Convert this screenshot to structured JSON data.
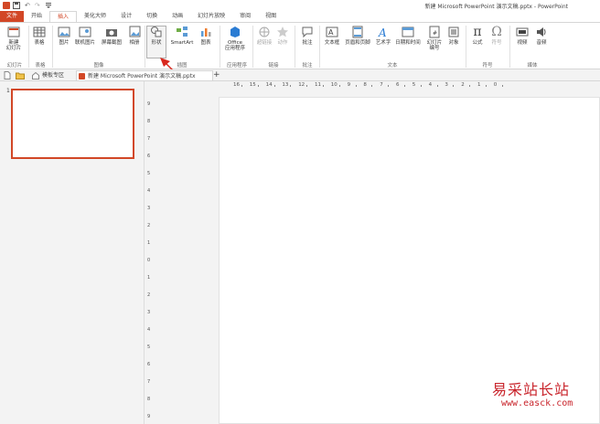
{
  "quick_access": {
    "undo": "↶",
    "redo": "↷"
  },
  "window_title": "新建 Microsoft PowerPoint 演示文稿.pptx - PowerPoint",
  "tabs": [
    "文件",
    "开始",
    "插入",
    "美化大师",
    "设计",
    "切换",
    "动画",
    "幻灯片放映",
    "审阅",
    "视图"
  ],
  "ribbon": {
    "new_slide": [
      "新建",
      "幻灯片"
    ],
    "table": "表格",
    "picture": "图片",
    "online_picture": "联机图片",
    "screenshot": "屏幕截图",
    "album": "相册",
    "shapes": "形状",
    "smartart": "SmartArt",
    "chart": "图表",
    "office_apps": [
      "Office",
      "应用程序"
    ],
    "hyperlink": "超链接",
    "action": "动作",
    "comment": "批注",
    "textbox": "文本框",
    "header_footer": "页眉和页脚",
    "wordart": "艺术字",
    "datetime": "日期和时间",
    "slide_number": [
      "幻灯片",
      "编号"
    ],
    "object": "对象",
    "equation": "公式",
    "symbol": "符号",
    "video": "视频",
    "audio": "音频",
    "groups": {
      "slides": "幻灯片",
      "tables": "表格",
      "images": "图像",
      "illustrations": "插图",
      "apps": "应用程序",
      "links": "链接",
      "comments": "批注",
      "text": "文本",
      "symbols": "符号",
      "media": "媒体"
    }
  },
  "doc_tabs": {
    "template": "模板专区",
    "document": "新建 Microsoft PowerPoint 演示文稿.pptx",
    "add": "+"
  },
  "thumbnail": {
    "number": "1"
  },
  "hruler": [
    "16",
    "15",
    "14",
    "13",
    "12",
    "11",
    "10",
    "9",
    "8",
    "7",
    "6",
    "5",
    "4",
    "3",
    "2",
    "1",
    "0"
  ],
  "vruler": [
    "9",
    "8",
    "7",
    "6",
    "5",
    "4",
    "3",
    "2",
    "1",
    "0",
    "1",
    "2",
    "3",
    "4",
    "5",
    "6",
    "7",
    "8",
    "9"
  ],
  "watermark": {
    "text": "易采站长站",
    "url": "www.easck.com"
  },
  "colors": {
    "accent": "#d24726",
    "watermark": "#c9252c"
  }
}
